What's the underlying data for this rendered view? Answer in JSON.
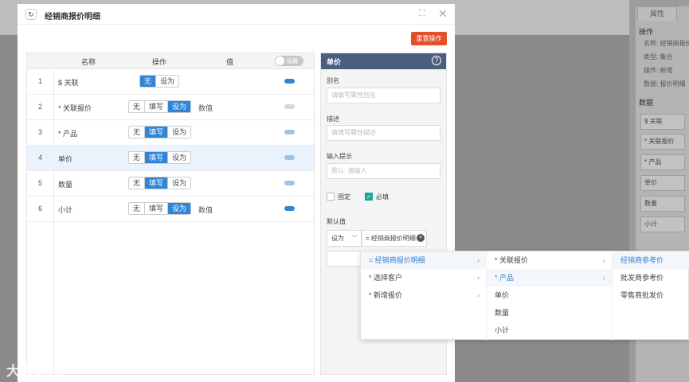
{
  "background": {
    "tab": "属性",
    "section_ops": "操作",
    "ops_lines": [
      "名称: 经销商报价",
      "类型: 集合",
      "操作: 新增",
      "数据: 报价明细"
    ],
    "section_data": "数据",
    "data_boxes": [
      "$ 关联",
      "* 关联报价",
      "* 产品",
      "单价",
      "数量",
      "小计"
    ]
  },
  "modal": {
    "title": "经销商报价明细",
    "refresh_icon": "↻",
    "reset_label": "重置操作"
  },
  "table": {
    "headers": {
      "name": "名称",
      "op": "操作",
      "value": "值"
    },
    "hide_toggle_label": "隐藏",
    "rows": [
      {
        "num": "1",
        "name": "$ 关联",
        "ops": [
          "无",
          "设为"
        ],
        "value": ""
      },
      {
        "num": "2",
        "name": "* 关联报价",
        "ops": [
          "无",
          "填写",
          "设为"
        ],
        "value": "数值"
      },
      {
        "num": "3",
        "name": "* 产品",
        "ops": [
          "无",
          "填写",
          "设为"
        ],
        "value": ""
      },
      {
        "num": "4",
        "name": "单价",
        "ops": [
          "无",
          "填写",
          "设为"
        ],
        "value": ""
      },
      {
        "num": "5",
        "name": "数量",
        "ops": [
          "无",
          "填写",
          "设为"
        ],
        "value": ""
      },
      {
        "num": "6",
        "name": "小计",
        "ops": [
          "无",
          "填写",
          "设为"
        ],
        "value": "数值"
      }
    ]
  },
  "prop": {
    "title": "单价",
    "alias_label": "别名",
    "alias_placeholder": "请填写属性别名",
    "desc_label": "描述",
    "desc_placeholder": "请填写属性描述",
    "hint_label": "输入提示",
    "hint_placeholder": "默认: 请输入",
    "fixed_label": "固定",
    "required_label": "必填",
    "default_label": "默认值",
    "default_mode": "设为",
    "default_expr": "= 经销商报价明细"
  },
  "cascade": {
    "col1": [
      "= 经销商报价明细",
      "* 选择客户",
      "* 新增报价"
    ],
    "col2": [
      "* 关联报价",
      "* 产品",
      "单价",
      "数量",
      "小计"
    ],
    "col3": [
      "经销商参考价",
      "批发商参考价",
      "零售商批发价"
    ]
  },
  "watermark": "大数跨境"
}
